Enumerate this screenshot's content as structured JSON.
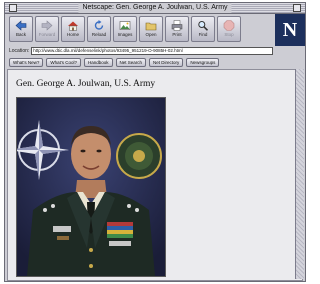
{
  "window": {
    "title": "Netscape: Gen. George A. Joulwan, U.S. Army"
  },
  "toolbar": {
    "buttons": [
      {
        "label": "Back",
        "icon": "back-arrow-icon",
        "enabled": true
      },
      {
        "label": "Forward",
        "icon": "forward-arrow-icon",
        "enabled": false
      },
      {
        "label": "Home",
        "icon": "home-icon",
        "enabled": true
      },
      {
        "label": "Reload",
        "icon": "reload-icon",
        "enabled": true
      },
      {
        "label": "Images",
        "icon": "images-icon",
        "enabled": true
      },
      {
        "label": "Open",
        "icon": "open-icon",
        "enabled": true
      },
      {
        "label": "Print",
        "icon": "print-icon",
        "enabled": true
      },
      {
        "label": "Find",
        "icon": "find-icon",
        "enabled": true
      },
      {
        "label": "Stop",
        "icon": "stop-icon",
        "enabled": false
      }
    ],
    "logo": "N"
  },
  "location": {
    "label": "Location:",
    "url": "http://www.dtic.dla.mil/defenselink/photos/93495_951219-O-9085H-02.html"
  },
  "directory_buttons": [
    "What's New?",
    "What's Cool?",
    "Handbook",
    "Net Search",
    "Net Directory",
    "Newsgroups"
  ],
  "page": {
    "heading": "Gen. George A. Joulwan, U.S. Army",
    "image_alt": "official portrait photograph"
  },
  "colors": {
    "window_chrome": "#cdcdd4",
    "content_bg": "#ebebee",
    "portrait_backdrop": "#2a2f52"
  }
}
